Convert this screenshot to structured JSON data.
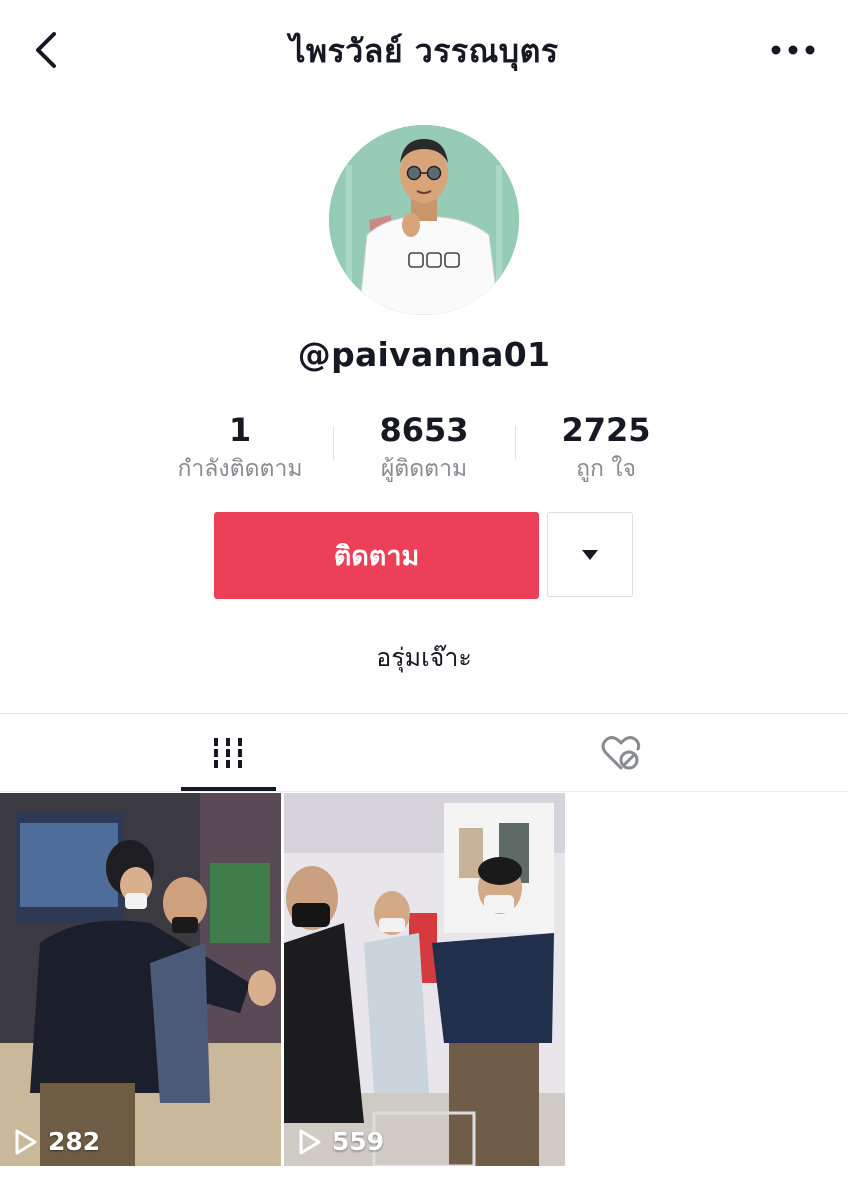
{
  "header": {
    "title": "ไพรวัลย์ วรรณบุตร",
    "back_icon": "chevron-left-icon",
    "more_icon": "more-horizontal-icon"
  },
  "profile": {
    "username": "@paivanna01",
    "bio": "อรุ่มเจ๊าะ"
  },
  "stats": [
    {
      "value": "1",
      "label": "กำลังติดตาม"
    },
    {
      "value": "8653",
      "label": "ผู้ติดตาม"
    },
    {
      "value": "2725",
      "label": "ถูก ใจ"
    }
  ],
  "actions": {
    "follow_label": "ติดตาม",
    "dropdown_icon": "caret-down-icon"
  },
  "tabs": [
    {
      "name": "videos",
      "icon": "grid-icon",
      "active": true
    },
    {
      "name": "liked",
      "icon": "heart-lock-icon",
      "active": false
    }
  ],
  "videos": [
    {
      "views": "282"
    },
    {
      "views": "559"
    }
  ],
  "colors": {
    "accent": "#ec4059",
    "text": "#161823",
    "secondary": "#8a8b91"
  }
}
